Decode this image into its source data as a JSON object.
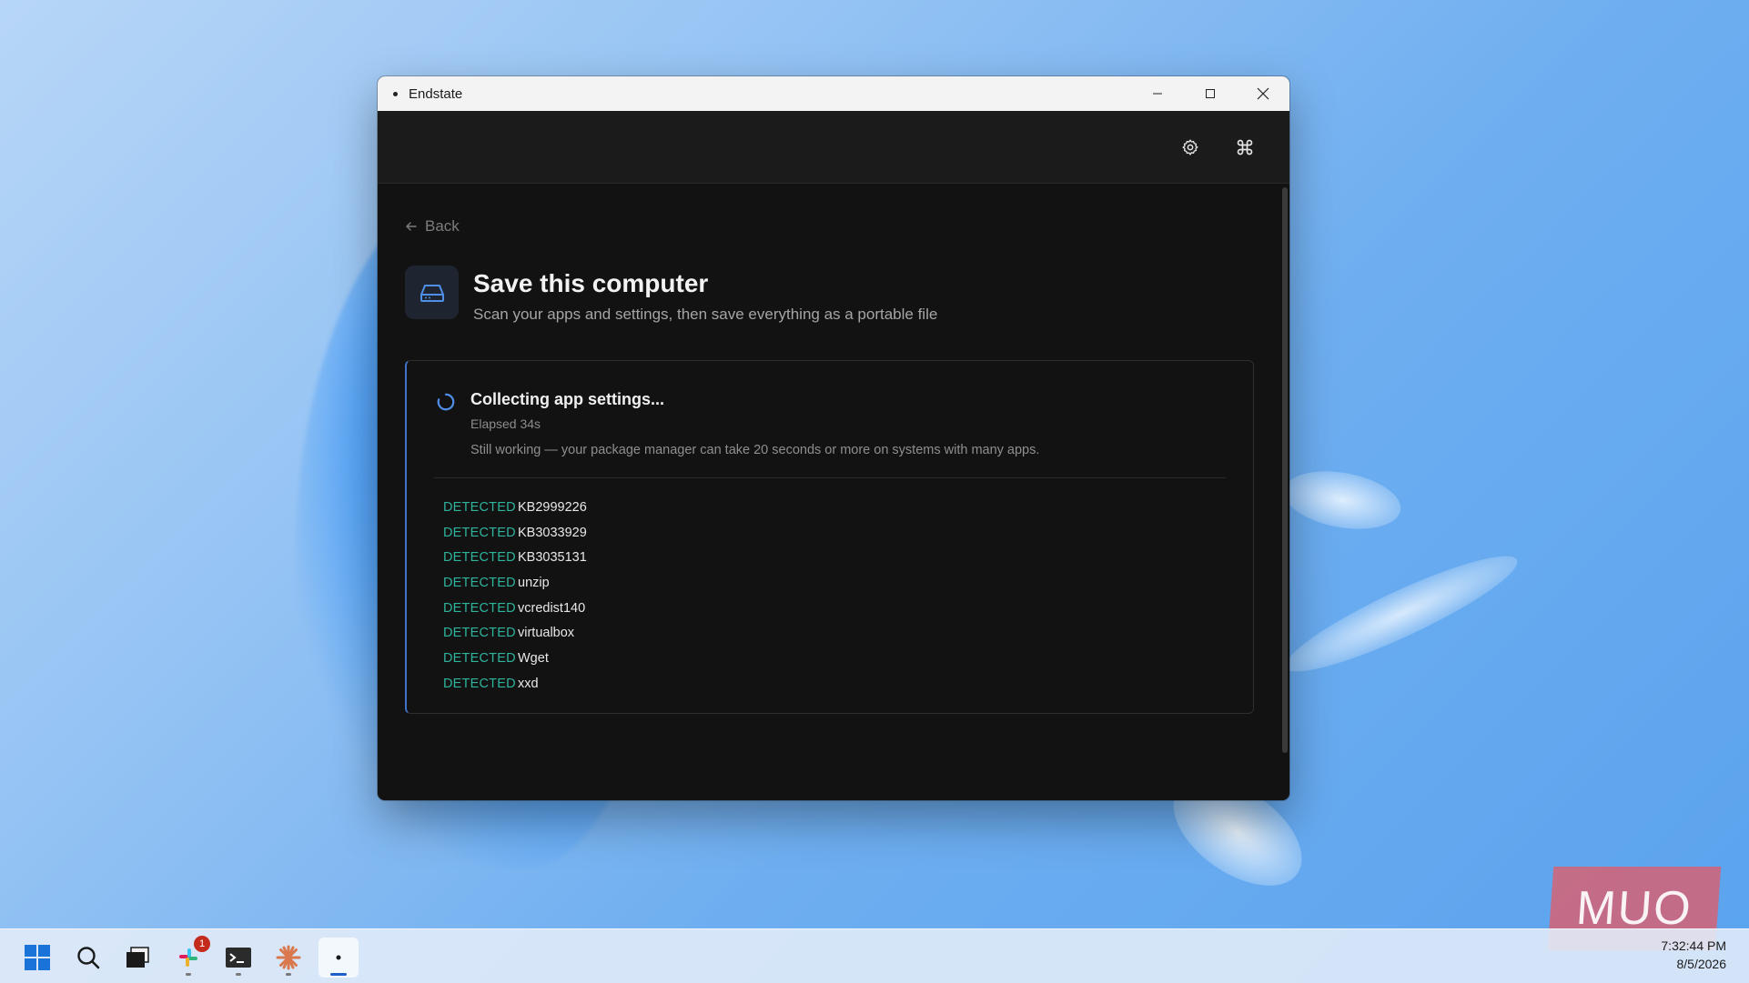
{
  "window": {
    "title": "Endstate",
    "controls": {
      "minimize": "–",
      "maximize": "□",
      "close": "✕"
    }
  },
  "header": {
    "icons": [
      "gear-icon",
      "command-icon"
    ]
  },
  "page": {
    "back_label": "Back",
    "title": "Save this computer",
    "subtitle": "Scan your apps and settings, then save everything as a portable file"
  },
  "progress": {
    "status": "Collecting app settings...",
    "elapsed": "Elapsed 34s",
    "note": "Still working — your package manager can take 20 seconds or more on systems with many apps.",
    "items": [
      {
        "tag": "DETECTED",
        "name": "KB2999226"
      },
      {
        "tag": "DETECTED",
        "name": "KB3033929"
      },
      {
        "tag": "DETECTED",
        "name": "KB3035131"
      },
      {
        "tag": "DETECTED",
        "name": "unzip"
      },
      {
        "tag": "DETECTED",
        "name": "vcredist140"
      },
      {
        "tag": "DETECTED",
        "name": "virtualbox"
      },
      {
        "tag": "DETECTED",
        "name": "Wget"
      },
      {
        "tag": "DETECTED",
        "name": "xxd"
      }
    ]
  },
  "taskbar": {
    "apps": [
      "windows-start-icon",
      "search-icon",
      "task-view-icon",
      "slack-icon",
      "terminal-icon",
      "claude-icon",
      "endstate-icon"
    ],
    "slack_badge": "1",
    "active_app": "endstate-icon"
  },
  "clock": {
    "time": "7:32:44 PM",
    "date": "8/5/2026"
  },
  "watermark": "MUO",
  "colors": {
    "accent": "#3f73c9",
    "detected": "#2fb39c",
    "background": "#121212"
  }
}
